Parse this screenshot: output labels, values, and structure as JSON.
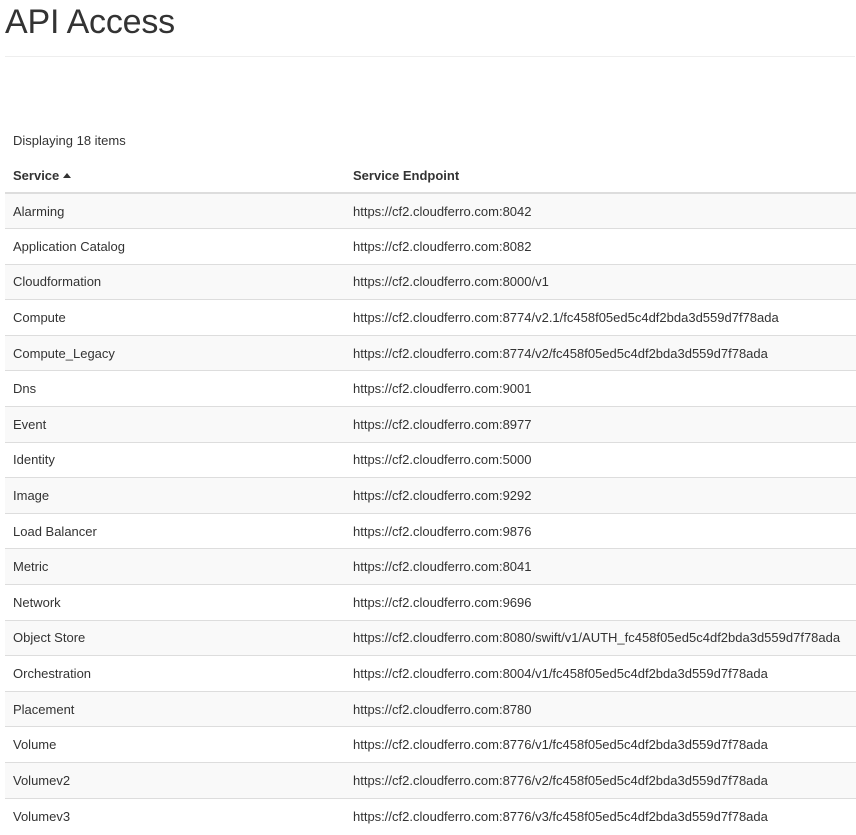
{
  "header": {
    "title": "API Access"
  },
  "table": {
    "count_text": "Displaying 18 items",
    "columns": {
      "service": "Service",
      "endpoint": "Service Endpoint"
    },
    "sort": {
      "column": "service",
      "direction": "ascending"
    },
    "rows": [
      {
        "service": "Alarming",
        "endpoint": "https://cf2.cloudferro.com:8042"
      },
      {
        "service": "Application Catalog",
        "endpoint": "https://cf2.cloudferro.com:8082"
      },
      {
        "service": "Cloudformation",
        "endpoint": "https://cf2.cloudferro.com:8000/v1"
      },
      {
        "service": "Compute",
        "endpoint": "https://cf2.cloudferro.com:8774/v2.1/fc458f05ed5c4df2bda3d559d7f78ada"
      },
      {
        "service": "Compute_Legacy",
        "endpoint": "https://cf2.cloudferro.com:8774/v2/fc458f05ed5c4df2bda3d559d7f78ada"
      },
      {
        "service": "Dns",
        "endpoint": "https://cf2.cloudferro.com:9001"
      },
      {
        "service": "Event",
        "endpoint": "https://cf2.cloudferro.com:8977"
      },
      {
        "service": "Identity",
        "endpoint": "https://cf2.cloudferro.com:5000"
      },
      {
        "service": "Image",
        "endpoint": "https://cf2.cloudferro.com:9292"
      },
      {
        "service": "Load Balancer",
        "endpoint": "https://cf2.cloudferro.com:9876"
      },
      {
        "service": "Metric",
        "endpoint": "https://cf2.cloudferro.com:8041"
      },
      {
        "service": "Network",
        "endpoint": "https://cf2.cloudferro.com:9696"
      },
      {
        "service": "Object Store",
        "endpoint": "https://cf2.cloudferro.com:8080/swift/v1/AUTH_fc458f05ed5c4df2bda3d559d7f78ada"
      },
      {
        "service": "Orchestration",
        "endpoint": "https://cf2.cloudferro.com:8004/v1/fc458f05ed5c4df2bda3d559d7f78ada"
      },
      {
        "service": "Placement",
        "endpoint": "https://cf2.cloudferro.com:8780"
      },
      {
        "service": "Volume",
        "endpoint": "https://cf2.cloudferro.com:8776/v1/fc458f05ed5c4df2bda3d559d7f78ada"
      },
      {
        "service": "Volumev2",
        "endpoint": "https://cf2.cloudferro.com:8776/v2/fc458f05ed5c4df2bda3d559d7f78ada"
      },
      {
        "service": "Volumev3",
        "endpoint": "https://cf2.cloudferro.com:8776/v3/fc458f05ed5c4df2bda3d559d7f78ada"
      }
    ]
  }
}
